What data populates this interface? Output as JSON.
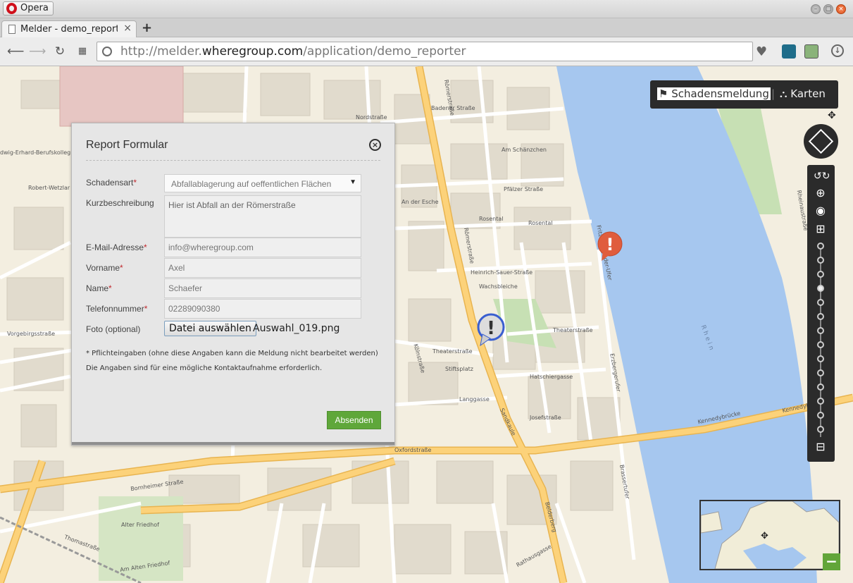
{
  "browser": {
    "app_button": "Opera",
    "tab_title": "Melder - demo_reporter",
    "new_tab": "+",
    "url_prefix": "http://melder.",
    "url_host": "wheregroup.com",
    "url_path": "/application/demo_reporter"
  },
  "topbar": {
    "report_label": "Schadensmeldung",
    "maps_label": "Karten"
  },
  "dialog": {
    "title": "Report Formular",
    "fields": {
      "damage_type": {
        "label": "Schadensart",
        "value": "Abfallablagerung auf oeffentlichen Flächen"
      },
      "description": {
        "label": "Kurzbeschreibung",
        "value": "Hier ist Abfall an der Römerstraße"
      },
      "email": {
        "label": "E-Mail-Adresse",
        "value": "info@wheregroup.com"
      },
      "firstname": {
        "label": "Vorname",
        "value": "Axel"
      },
      "lastname": {
        "label": "Name",
        "value": "Schaefer"
      },
      "phone": {
        "label": "Telefonnummer",
        "value": "02289090380"
      },
      "photo": {
        "label": "Foto (optional)",
        "button": "Datei auswählen",
        "file": "Auswahl_019.png"
      }
    },
    "required_mark": "*",
    "note1": "* Pflichteingaben (ohne diese Angaben kann die Meldung nicht bearbeitet werden)",
    "note2": "Die Angaben sind für eine mögliche Kontaktaufnahme erforderlich.",
    "submit": "Absenden"
  },
  "map_labels": {
    "roemerstrasse": "Römerstraße",
    "badener": "Badener Straße",
    "nordstrasse": "Nordstraße",
    "am_schaenzchen": "Am Schänzchen",
    "pfaelzer": "Pfälzer Straße",
    "an_der_esche": "An der Esche",
    "rosental": "Rosental",
    "heinrich": "Heinrich-Sauer-Straße",
    "wachsbleiche": "Wachsbleiche",
    "theater": "Theaterstraße",
    "koelnstrasse": "Kölnstraße",
    "stiftsplatz": "Stiftsplatz",
    "hatschier": "Hatschiergasse",
    "langgasse": "Langgasse",
    "sandkaule": "Sandkaule",
    "josefstrasse": "Josefstraße",
    "kennedy": "Kennedybrücke",
    "oxford": "Oxfordstraße",
    "bornheimer": "Bornheimer Straße",
    "alter_friedhof": "Alter Friedhof",
    "thomas": "Thomastraße",
    "am_alten_friedhof": "Am Alten Friedhof",
    "rathausgasse": "Rathausgasse",
    "vorgebirgs": "Vorgebirgsstraße",
    "erhard": "dwig-Erhard-Berufskolleg",
    "robert": "Robert-Wetzlar",
    "rhein": "R h e i n",
    "belderberg": "Belderberg",
    "brassert": "Brassertufer",
    "fritz": "Fritz-Schroeder-Ufer",
    "erzberger": "Erzbergerufer",
    "rheinaue": "Rheinaustraße"
  },
  "colors": {
    "water": "#a6c7ef",
    "land": "#f3eee0",
    "main_road": "#fcd27a",
    "submit_green": "#5fa73a",
    "marker_red": "#e05d3d"
  },
  "icons": {
    "report": "bell-icon",
    "maps": "sitemap-icon",
    "pan": "pan-arrows-icon",
    "zoom_in": "zoom-in-icon",
    "globe": "globe-icon"
  }
}
